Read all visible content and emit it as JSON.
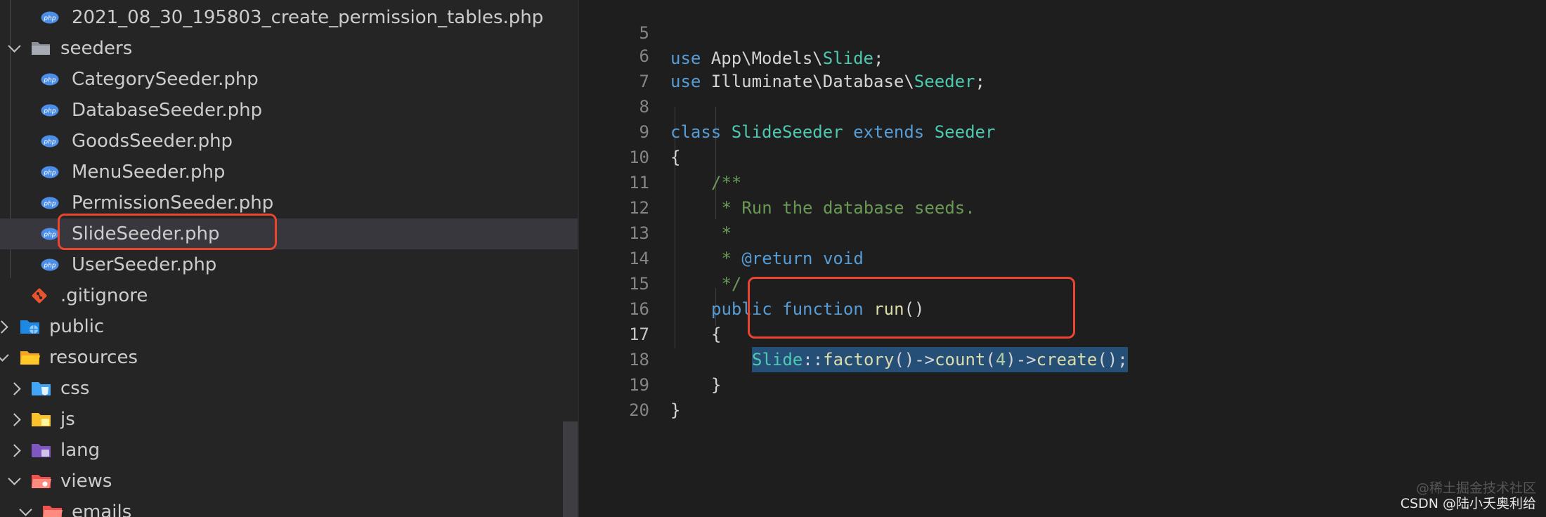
{
  "explorer": {
    "items": [
      {
        "label": "2021_08_30_195803_create_permission_tables.php",
        "icon": "php-file-icon",
        "chevron": "none"
      },
      {
        "label": "seeders",
        "icon": "folder-open-icon",
        "chevron": "down"
      },
      {
        "label": "CategorySeeder.php",
        "icon": "php-file-icon",
        "chevron": "none"
      },
      {
        "label": "DatabaseSeeder.php",
        "icon": "php-file-icon",
        "chevron": "none"
      },
      {
        "label": "GoodsSeeder.php",
        "icon": "php-file-icon",
        "chevron": "none"
      },
      {
        "label": "MenuSeeder.php",
        "icon": "php-file-icon",
        "chevron": "none"
      },
      {
        "label": "PermissionSeeder.php",
        "icon": "php-file-icon",
        "chevron": "none"
      },
      {
        "label": "SlideSeeder.php",
        "icon": "php-file-icon",
        "chevron": "none",
        "selected": true
      },
      {
        "label": "UserSeeder.php",
        "icon": "php-file-icon",
        "chevron": "none"
      },
      {
        "label": ".gitignore",
        "icon": "git-icon",
        "chevron": "none"
      },
      {
        "label": "public",
        "icon": "public-folder-icon",
        "chevron": "right"
      },
      {
        "label": "resources",
        "icon": "folder-open-icon",
        "chevron": "down"
      },
      {
        "label": "css",
        "icon": "css-folder-icon",
        "chevron": "right"
      },
      {
        "label": "js",
        "icon": "js-folder-icon",
        "chevron": "right"
      },
      {
        "label": "lang",
        "icon": "lang-folder-icon",
        "chevron": "right"
      },
      {
        "label": "views",
        "icon": "views-folder-icon",
        "chevron": "down"
      },
      {
        "label": "emails",
        "icon": "emails-folder-icon",
        "chevron": "down"
      }
    ]
  },
  "editor": {
    "line_numbers": [
      "5",
      "6",
      "7",
      "8",
      "9",
      "10",
      "11",
      "12",
      "13",
      "14",
      "15",
      "16",
      "17",
      "18",
      "19",
      "20"
    ],
    "active_line": "17",
    "tokens": {
      "l5_use": "use",
      "l5_ns": " App\\Models\\",
      "l5_cls": "Slide",
      "l5_end": ";",
      "l6_use": "use",
      "l6_ns": " Illuminate\\Database\\",
      "l6_cls": "Seeder",
      "l6_end": ";",
      "l8_class": "class",
      "l8_name": "SlideSeeder",
      "l8_extends": "extends",
      "l8_parent": "Seeder",
      "l9_brace": "{",
      "l10_comment": "/**",
      "l11_comment": " * Run the database seeds.",
      "l12_comment": " *",
      "l13_star": " * ",
      "l13_tag": "@return",
      "l13_type": "void",
      "l14_comment": " */",
      "l15_public": "public",
      "l15_function": "function",
      "l15_name": "run",
      "l15_parens": "()",
      "l16_brace": "{",
      "l17_cls": "Slide",
      "l17_sep": "::",
      "l17_factory": "factory",
      "l17_p1": "()->",
      "l17_count": "count",
      "l17_po": "(",
      "l17_num": "4",
      "l17_pc": ")->",
      "l17_create": "create",
      "l17_end": "();",
      "l18_brace": "}",
      "l19_brace": "}"
    }
  },
  "watermark": {
    "line1": "@稀土掘金技术社区",
    "line2": "CSDN @陆小夭奥利给"
  },
  "colors": {
    "highlight": "#e9452f",
    "keyword": "#569cd6",
    "class": "#4ec9b0",
    "function": "#dcdcaa",
    "comment": "#6a9955",
    "selection": "#264f78"
  }
}
